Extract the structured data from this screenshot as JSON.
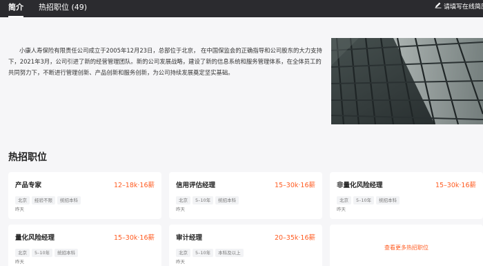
{
  "header": {
    "tabs": [
      {
        "label": "简介"
      },
      {
        "label": "热招职位 (49)"
      }
    ],
    "feedback_label": "请填写在线简历"
  },
  "intro": {
    "text": "小康人寿保险有限责任公司成立于2005年12月23日，总部位于北京， 在中国保监会的正确指导和公司股东的大力支持下，2021年3月，公司引进了新的经营管理团队。新的公司发展战略，建设了新的信息系统和服务管理体系，在全体员工的共同努力下，不断进行管理创新、产品创新和服务创新，为公司持续发展奠定坚实基础。"
  },
  "jobs_section": {
    "title": "热招职位",
    "jobs": [
      {
        "title": "产品专家",
        "salary": "12–18k·16薪",
        "tags": [
          "北京",
          "经验不限",
          "统招本科"
        ],
        "date": "昨天"
      },
      {
        "title": "信用评估经理",
        "salary": "15–30k·16薪",
        "tags": [
          "北京",
          "5–10年",
          "统招本科"
        ],
        "date": "昨天"
      },
      {
        "title": "非量化风险经理",
        "salary": "15–30k·16薪",
        "tags": [
          "北京",
          "5–10年",
          "统招本科"
        ],
        "date": "昨天"
      },
      {
        "title": "量化风险经理",
        "salary": "15–30k·16薪",
        "tags": [
          "北京",
          "5–10年",
          "统招本科"
        ],
        "date": "昨天"
      },
      {
        "title": "审计经理",
        "salary": "20–35k·16薪",
        "tags": [
          "北京",
          "5–10年",
          "本科及以上"
        ],
        "date": "昨天"
      }
    ],
    "more_label": "查看更多热招职位"
  },
  "colors": {
    "accent": "#ff5a1f",
    "header_bg": "#2b2b2f",
    "page_bg": "#f6f6f8"
  }
}
